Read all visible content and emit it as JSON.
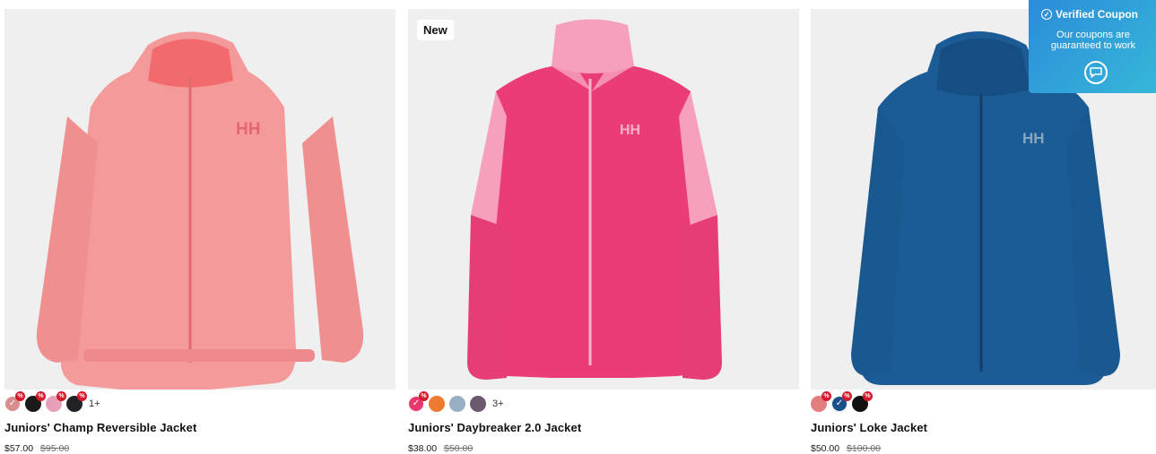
{
  "products": [
    {
      "name": "Juniors' Champ Reversible Jacket",
      "price": "$57.00",
      "was_price": "$95.00",
      "badge": "",
      "more": "1+",
      "colors": [
        "#d98c8c",
        "#1a1a1a",
        "#e8a0b8",
        "#1f2326"
      ]
    },
    {
      "name": "Juniors' Daybreaker 2.0 Jacket",
      "price": "$38.00",
      "was_price": "$50.00",
      "badge": "New",
      "more": "3+",
      "colors": [
        "#e8396f",
        "#ee7a2f",
        "#98aec2",
        "#6b5a6e"
      ]
    },
    {
      "name": "Juniors' Loke Jacket",
      "price": "$50.00",
      "was_price": "$100.00",
      "badge": "",
      "more": "",
      "colors": [
        "#e27e80",
        "#1b4f8a",
        "#111111"
      ]
    }
  ],
  "coupon": {
    "title": "Verified Coupon",
    "subtitle": "Our coupons are guaranteed to work"
  },
  "icons": {
    "check": "✓",
    "percent": "%",
    "coupon_action": "chat-icon"
  },
  "logo_text": "HH"
}
